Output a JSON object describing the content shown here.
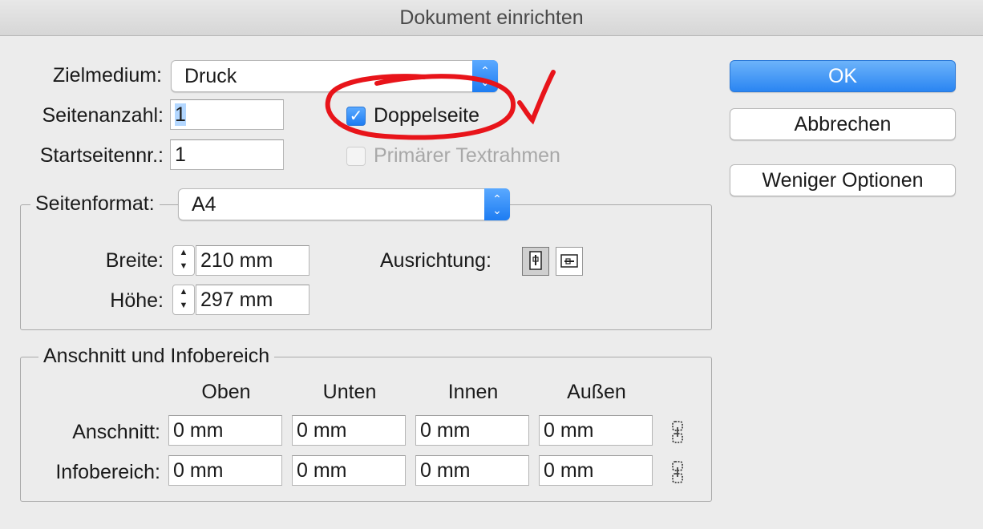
{
  "window": {
    "title": "Dokument einrichten"
  },
  "top": {
    "zielmedium_label": "Zielmedium:",
    "zielmedium_value": "Druck",
    "seitenanzahl_label": "Seitenanzahl:",
    "seitenanzahl_value": "1",
    "startseite_label": "Startseitennr.:",
    "startseite_value": "1",
    "doppelseite_label": "Doppelseite",
    "doppelseite_checked": true,
    "primaer_label": "Primärer Textrahmen",
    "primaer_checked": false
  },
  "buttons": {
    "ok": "OK",
    "cancel": "Abbrechen",
    "fewer": "Weniger Optionen"
  },
  "seitenformat": {
    "label": "Seitenformat:",
    "value": "A4",
    "breite_label": "Breite:",
    "breite_value": "210 mm",
    "hoehe_label": "Höhe:",
    "hoehe_value": "297 mm",
    "ausrichtung_label": "Ausrichtung:",
    "orientation_selected": "portrait"
  },
  "anschnitt": {
    "title": "Anschnitt und Infobereich",
    "columns": [
      "Oben",
      "Unten",
      "Innen",
      "Außen"
    ],
    "rows": [
      {
        "label": "Anschnitt:",
        "values": [
          "0 mm",
          "0 mm",
          "0 mm",
          "0 mm"
        ]
      },
      {
        "label": "Infobereich:",
        "values": [
          "0 mm",
          "0 mm",
          "0 mm",
          "0 mm"
        ]
      }
    ]
  },
  "icons": {
    "popup_arrows": "up-down-chevron-icon",
    "stepper": "stepper-arrows-icon",
    "portrait": "portrait-orientation-icon",
    "landscape": "landscape-orientation-icon",
    "link": "chain-link-icon"
  },
  "colors": {
    "accent": "#2a85f2",
    "annotation": "#e8141a"
  }
}
